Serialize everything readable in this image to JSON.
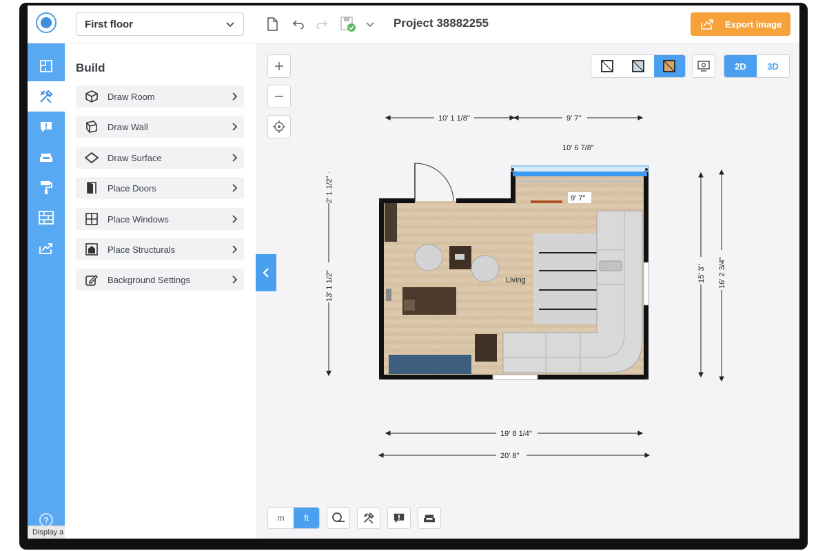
{
  "header": {
    "floor": "First floor",
    "project_title": "Project 38882255",
    "export_label": "Export image"
  },
  "rail": {
    "items": [
      "floorplan-icon",
      "build-tools-icon",
      "info-icon",
      "furniture-icon",
      "paint-roller-icon",
      "brick-wall-icon",
      "export-icon"
    ],
    "help_glyph": "?",
    "tooltip": "Display a menu"
  },
  "panel": {
    "title": "Build",
    "items": [
      {
        "label": "Draw Room",
        "icon": "cube-icon"
      },
      {
        "label": "Draw Wall",
        "icon": "wall-icon"
      },
      {
        "label": "Draw Surface",
        "icon": "diamond-icon"
      },
      {
        "label": "Place Doors",
        "icon": "door-icon"
      },
      {
        "label": "Place Windows",
        "icon": "window-icon"
      },
      {
        "label": "Place Structurals",
        "icon": "structural-icon"
      },
      {
        "label": "Background Settings",
        "icon": "edit-background-icon"
      }
    ]
  },
  "canvas": {
    "view_mode_2d": "2D",
    "view_mode_3d": "3D",
    "selected_view": "2D",
    "unit_m": "m",
    "unit_ft": "ft",
    "selected_unit": "ft"
  },
  "plan": {
    "room_label": "Living",
    "dims": {
      "top_left": "10' 1 1/8\"",
      "top_right": "9' 7\"",
      "window_width": "10' 6 7/8\"",
      "inner_small": "9' 7\"",
      "left_upper": "2' 1 1/2\"",
      "left_lower": "13' 1 1/2\"",
      "right_inner": "15' 3\"",
      "right_outer": "16' 2 3/4\"",
      "bottom_inner": "19' 8 1/4\"",
      "bottom_outer": "20' 8\""
    }
  },
  "colors": {
    "accent": "#4aa0ef",
    "export": "#f7a13a",
    "rail": "#58a8f2"
  }
}
